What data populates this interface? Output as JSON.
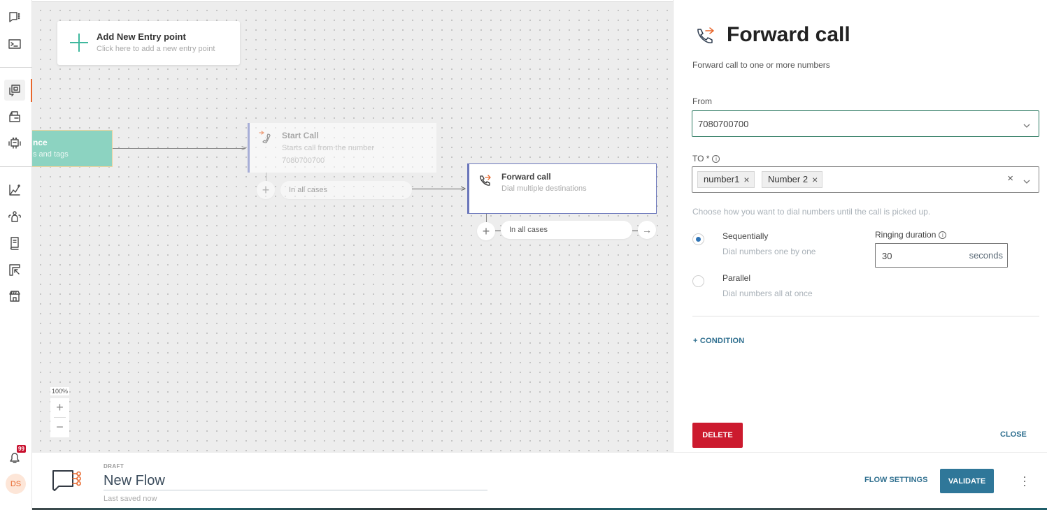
{
  "sidebar": {
    "items": [
      {
        "name": "conversations",
        "icon": "chat-dots-icon"
      },
      {
        "name": "terminal",
        "icon": "terminal-icon"
      },
      {
        "name": "flows",
        "icon": "flow-builder-icon",
        "active": true
      },
      {
        "name": "templates",
        "icon": "inbox-stack-icon"
      },
      {
        "name": "bots",
        "icon": "robot-icon"
      },
      {
        "name": "analytics",
        "icon": "chart-line-icon"
      },
      {
        "name": "contacts",
        "icon": "people-icon"
      },
      {
        "name": "knowledge",
        "icon": "book-icon"
      },
      {
        "name": "integrations",
        "icon": "frame-arrow-icon"
      },
      {
        "name": "store",
        "icon": "storefront-icon"
      }
    ],
    "notifications": {
      "count": "99"
    },
    "avatar": {
      "initials": "DS"
    }
  },
  "canvas": {
    "entry_point": {
      "title": "Add New Entry point",
      "subtitle": "Click here to add a new entry point"
    },
    "partial_node": {
      "title": "nce",
      "subtitle": "s and tags"
    },
    "nodes": [
      {
        "id": "start-call",
        "title": "Start Call",
        "subtitle": "Starts call from the number",
        "detail": "7080700700",
        "branch": "In all cases"
      },
      {
        "id": "forward-call",
        "title": "Forward call",
        "subtitle": "Dial multiple destinations",
        "branch": "In all cases"
      }
    ],
    "zoom_level": "100%",
    "zoom_in": "+",
    "zoom_out": "−"
  },
  "panel": {
    "title": "Forward call",
    "description": "Forward call to one or more numbers",
    "from": {
      "label": "From",
      "value": "7080700700"
    },
    "to": {
      "label": "TO *",
      "chips": [
        "number1",
        "Number 2"
      ]
    },
    "dial_helper": "Choose how you want to dial numbers until the call is picked up.",
    "dial_modes": [
      {
        "label": "Sequentially",
        "sub": "Dial numbers one by one",
        "checked": true
      },
      {
        "label": "Parallel",
        "sub": "Dial numbers all at once",
        "checked": false
      }
    ],
    "ringing": {
      "label": "Ringing duration",
      "value": "30",
      "unit": "seconds"
    },
    "condition_label": "+ CONDITION",
    "delete_label": "DELETE",
    "close_label": "CLOSE"
  },
  "bottombar": {
    "status": "DRAFT",
    "flow_name": "New Flow",
    "last_saved": "Last saved now",
    "flow_settings_label": "FLOW SETTINGS",
    "validate_label": "VALIDATE"
  },
  "colors": {
    "accent_orange": "#e8672c",
    "teal": "#3fb89e",
    "primary_blue": "#2f7799",
    "danger": "#cc1a2e",
    "node_border": "#6a76bb"
  }
}
